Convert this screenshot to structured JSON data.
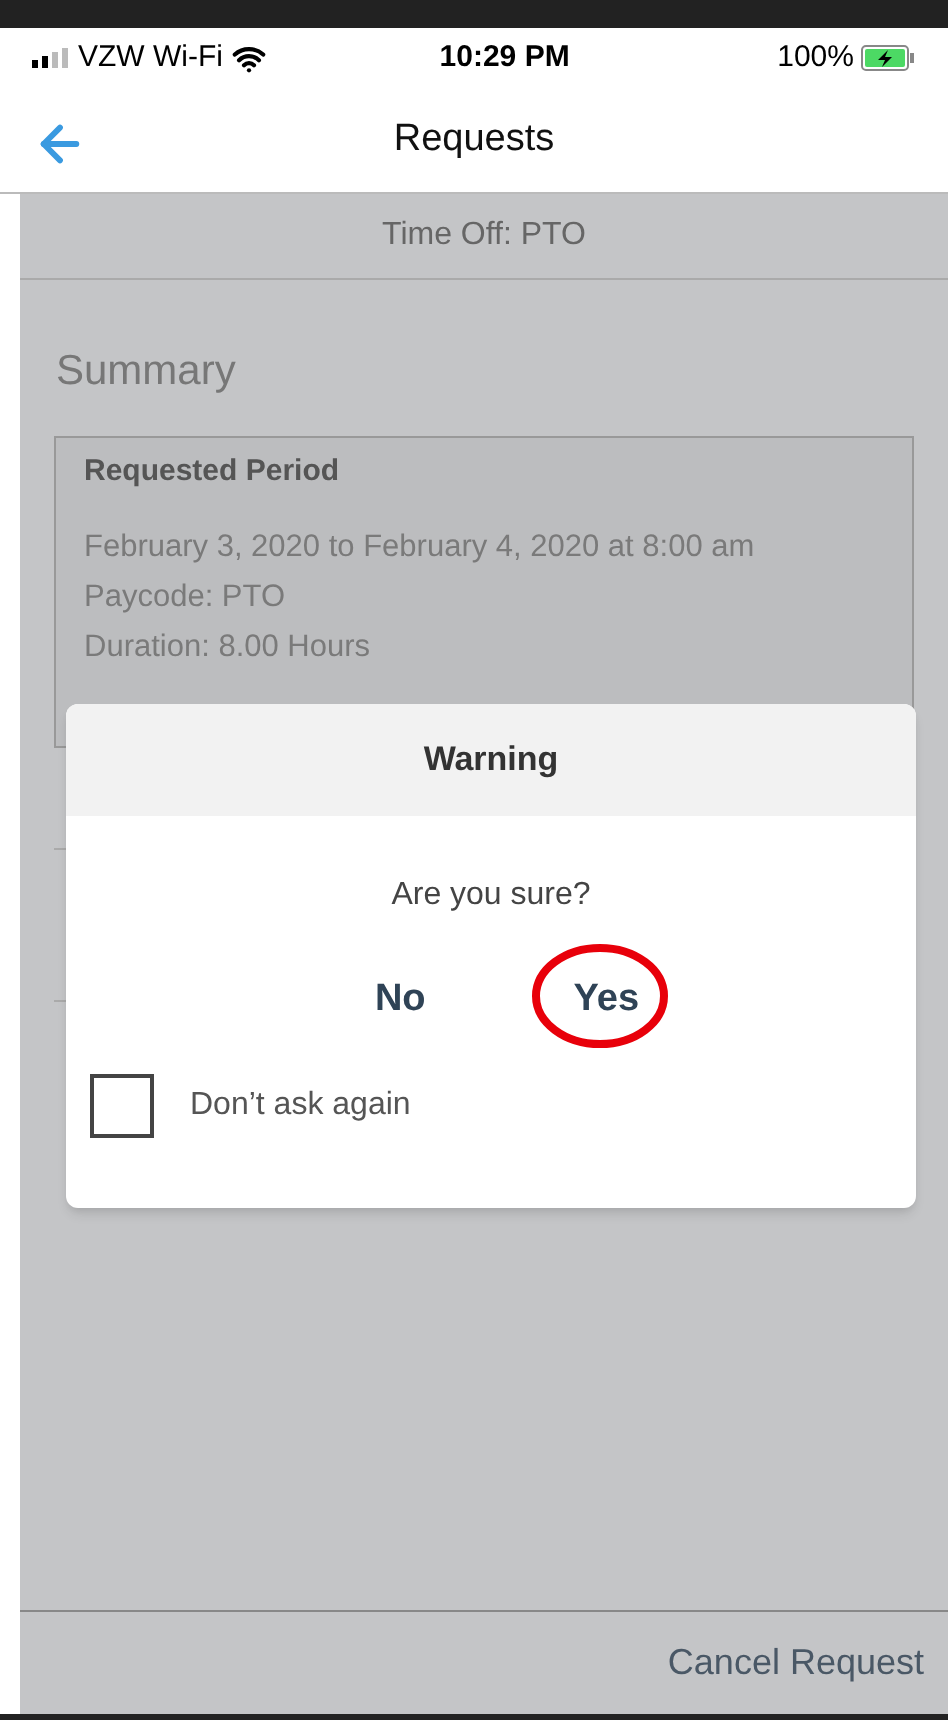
{
  "status_bar": {
    "carrier": "VZW Wi-Fi",
    "time": "10:29 PM",
    "battery": "100%",
    "charging": true
  },
  "header": {
    "title": "Requests"
  },
  "subheader": "Time Off: PTO",
  "summary": {
    "heading": "Summary",
    "card_title": "Requested Period",
    "lines": [
      "February 3, 2020 to February 4, 2020 at 8:00 am",
      "Paycode: PTO",
      "Duration: 8.00 Hours"
    ]
  },
  "dialog": {
    "title": "Warning",
    "message": "Are you sure?",
    "buttons": [
      {
        "label": "No",
        "circled": false
      },
      {
        "label": "Yes",
        "circled": true
      }
    ],
    "checkbox": {
      "label": "Don’t ask again",
      "checked": false
    }
  },
  "footer": {
    "action": "Cancel Request"
  }
}
